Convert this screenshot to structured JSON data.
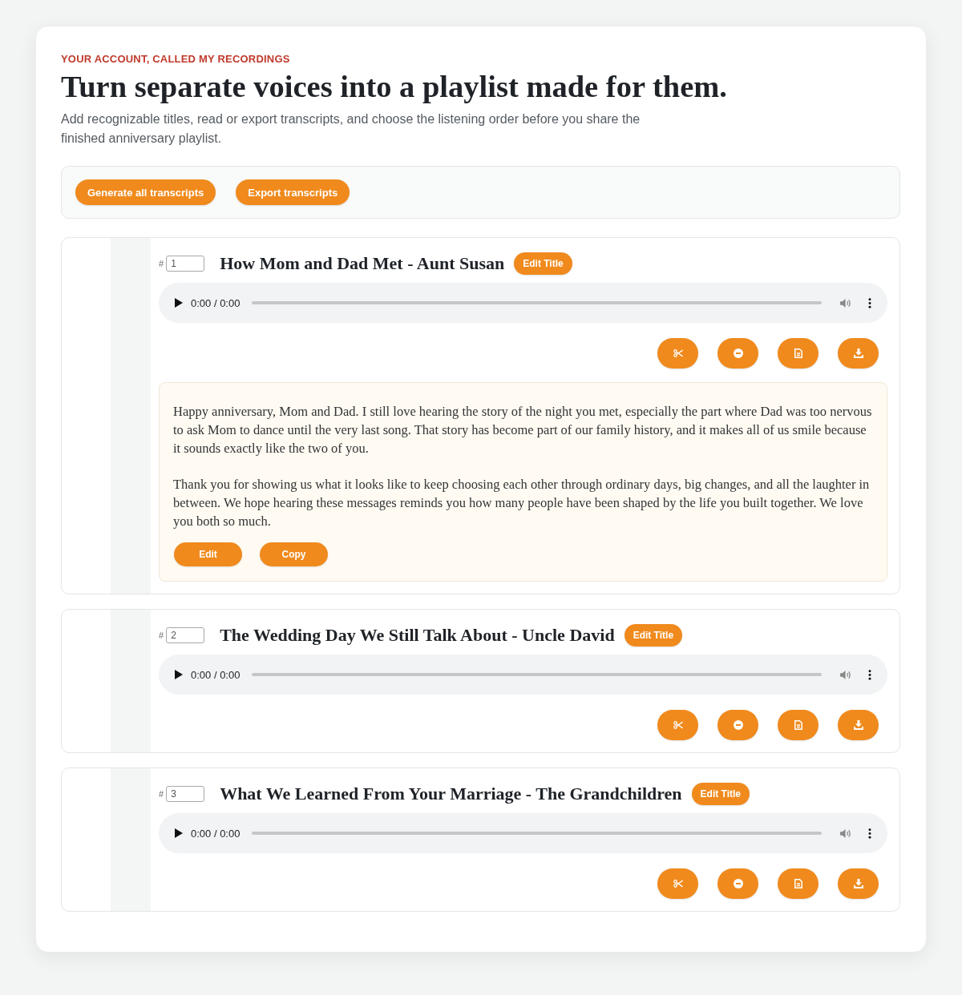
{
  "eyebrow": "YOUR ACCOUNT, CALLED MY RECORDINGS",
  "heading": "Turn separate voices into a playlist made for them.",
  "intro": "Add recognizable titles, read or export transcripts, and choose the listening order before you share the finished anniversary playlist.",
  "toolbar": {
    "buttons": [
      "Generate all transcripts",
      "Export transcripts"
    ]
  },
  "recordings": [
    {
      "order_prefix": "#",
      "order": "1",
      "title": "How Mom and Dad Met - Aunt Susan",
      "edit_button": "Edit Title",
      "player": {
        "time": "0:00 / 0:00"
      },
      "actions": [
        {
          "kind": "trim"
        },
        {
          "kind": "remove"
        },
        {
          "kind": "transcript"
        },
        {
          "kind": "download"
        }
      ],
      "transcript": {
        "paragraphs": [
          "Happy anniversary, Mom and Dad. I still love hearing the story of the night you met, especially the part where Dad was too nervous to ask Mom to dance until the very last song. That story has become part of our family history, and it makes all of us smile because it sounds exactly like the two of you.",
          "Thank you for showing us what it looks like to keep choosing each other through ordinary days, big changes, and all the laughter in between. We hope hearing these messages reminds you how many people have been shaped by the life you built together. We love you both so much."
        ],
        "buttons": [
          "Edit",
          "Copy"
        ]
      }
    },
    {
      "order_prefix": "#",
      "order": "2",
      "title": "The Wedding Day We Still Talk About - Uncle David",
      "edit_button": "Edit Title",
      "player": {
        "time": "0:00 / 0:00"
      },
      "actions": [
        {
          "kind": "trim"
        },
        {
          "kind": "remove"
        },
        {
          "kind": "transcript"
        },
        {
          "kind": "download"
        }
      ]
    },
    {
      "order_prefix": "#",
      "order": "3",
      "title": "What We Learned From Your Marriage - The Grandchildren",
      "edit_button": "Edit Title",
      "player": {
        "time": "0:00 / 0:00"
      },
      "actions": [
        {
          "kind": "trim"
        },
        {
          "kind": "remove"
        },
        {
          "kind": "transcript"
        },
        {
          "kind": "download"
        }
      ]
    }
  ]
}
